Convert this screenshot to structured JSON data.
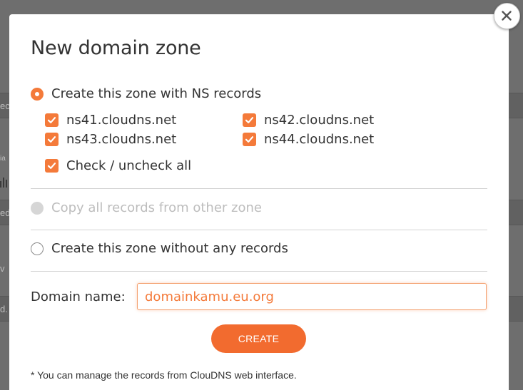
{
  "background_page": {
    "fragments": [
      "ec",
      "ia",
      "ed",
      "v",
      "d."
    ]
  },
  "modal": {
    "title": "New domain zone",
    "close_label": "×",
    "options": {
      "with_ns": {
        "label": "Create this zone with NS records",
        "selected": true,
        "nameservers": [
          "ns41.cloudns.net",
          "ns42.cloudns.net",
          "ns43.cloudns.net",
          "ns44.cloudns.net"
        ],
        "nameservers_checked": [
          true,
          true,
          true,
          true
        ],
        "check_all_label": "Check / uncheck all",
        "check_all_checked": true
      },
      "copy": {
        "label": "Copy all records from other zone",
        "selected": false,
        "disabled": true
      },
      "empty": {
        "label": "Create this zone without any records",
        "selected": false
      }
    },
    "domain": {
      "label": "Domain name:",
      "value": "domainkamu.eu.org"
    },
    "create_label": "CREATE",
    "footnote": "* You can manage the records from ClouDNS web interface."
  },
  "colors": {
    "accent": "#f47a3a",
    "button": "#f26b2f",
    "text": "#333333",
    "disabled_text": "#bdbdbd",
    "divider": "#d2d2d2"
  }
}
